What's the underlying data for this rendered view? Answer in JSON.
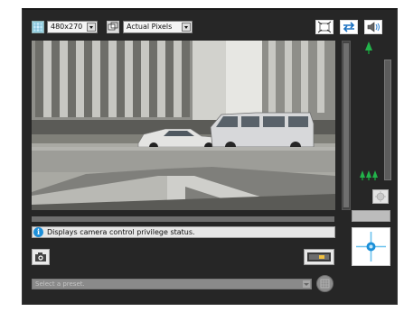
{
  "toolbar": {
    "resolution_value": "480x270",
    "display_size_value": "Actual Pixels",
    "icons": [
      "video-size-icon",
      "display-size-icon",
      "fullscreen-icon",
      "switch-icon",
      "audio-icon"
    ]
  },
  "status": {
    "message": "Displays camera control privilege status."
  },
  "preset": {
    "placeholder": "Select a preset."
  },
  "zoom": {
    "level": 0.97,
    "tele_icon": "tele-tree-icon",
    "wide_icon": "wide-trees-icon"
  },
  "colors": {
    "panel": "#262626",
    "accent": "#1a8fd8",
    "zoom_green": "#1fa63c"
  }
}
